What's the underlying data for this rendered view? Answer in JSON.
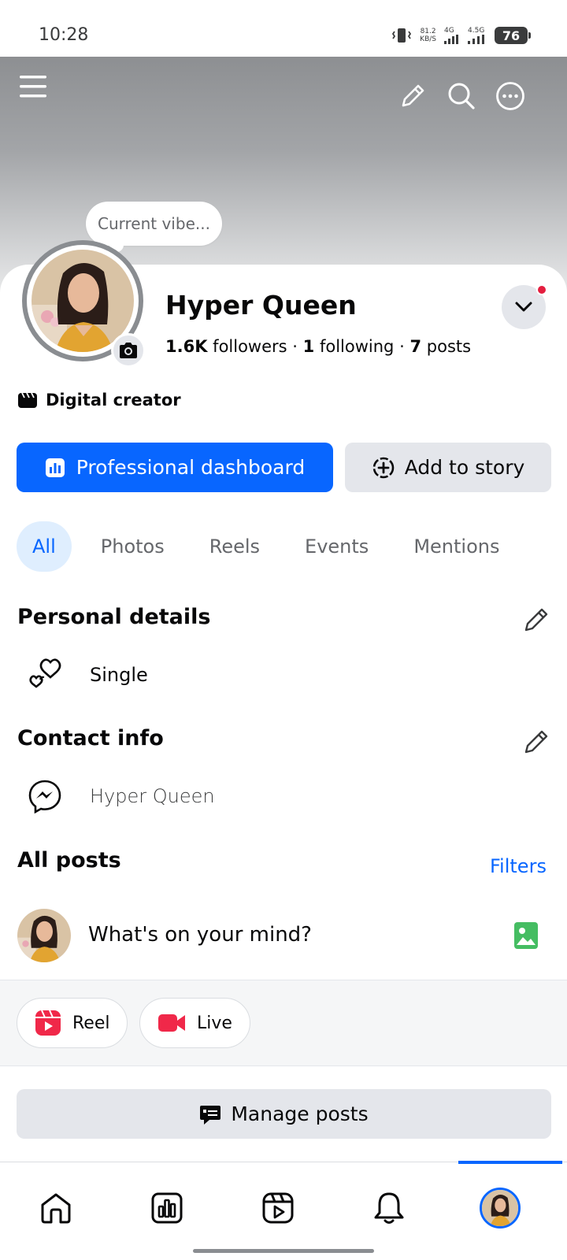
{
  "status_bar": {
    "time": "10:28",
    "net_speed_value": "81.2",
    "net_speed_unit": "KB/S",
    "sim1": "4G",
    "sim2": "4.5G",
    "battery": "76"
  },
  "header": {
    "icons": [
      "menu-icon",
      "pencil-icon",
      "search-icon",
      "more-icon"
    ]
  },
  "profile": {
    "vibe_prompt": "Current vibe...",
    "name": "Hyper Queen",
    "followers_count": "1.6K",
    "followers_label": "followers",
    "following_count": "1",
    "following_label": "following",
    "posts_count": "7",
    "posts_label": "posts",
    "separator": "·",
    "category": "Digital creator"
  },
  "actions": {
    "dashboard_label": "Professional dashboard",
    "add_story_label": "Add to story"
  },
  "tabs": [
    {
      "label": "All",
      "active": true
    },
    {
      "label": "Photos",
      "active": false
    },
    {
      "label": "Reels",
      "active": false
    },
    {
      "label": "Events",
      "active": false
    },
    {
      "label": "Mentions",
      "active": false
    }
  ],
  "personal_details": {
    "title": "Personal details",
    "relationship": "Single"
  },
  "contact_info": {
    "title": "Contact info",
    "messenger": "Hyper Queen"
  },
  "all_posts": {
    "title": "All posts",
    "filters_label": "Filters",
    "composer_prompt": "What's on your mind?"
  },
  "quick_actions": {
    "reel_label": "Reel",
    "live_label": "Live"
  },
  "manage_posts_label": "Manage posts",
  "colors": {
    "accent": "#0866ff",
    "notification": "#e41e3f",
    "photo_green": "#45bd62",
    "reel_red": "#f02849"
  }
}
